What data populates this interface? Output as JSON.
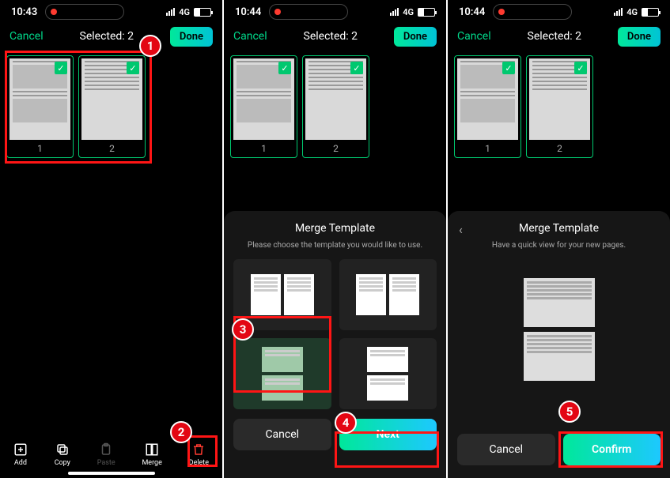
{
  "screens": [
    {
      "status": {
        "time": "10:43",
        "network": "4G"
      },
      "topbar": {
        "cancel": "Cancel",
        "title": "Selected: 2",
        "done": "Done"
      },
      "thumbs": [
        {
          "num": "1"
        },
        {
          "num": "2"
        }
      ],
      "toolbar": {
        "add": "Add",
        "copy": "Copy",
        "paste": "Paste",
        "merge": "Merge",
        "delete": "Delete"
      }
    },
    {
      "status": {
        "time": "10:44",
        "network": "4G"
      },
      "topbar": {
        "cancel": "Cancel",
        "title": "Selected: 2",
        "done": "Done"
      },
      "thumbs": [
        {
          "num": "1"
        },
        {
          "num": "2"
        }
      ],
      "sheet": {
        "title": "Merge Template",
        "subtitle": "Please choose the template you would like to use.",
        "cancel": "Cancel",
        "next": "Next"
      }
    },
    {
      "status": {
        "time": "10:44",
        "network": "4G"
      },
      "topbar": {
        "cancel": "Cancel",
        "title": "Selected: 2",
        "done": "Done"
      },
      "thumbs": [
        {
          "num": "1"
        },
        {
          "num": "2"
        }
      ],
      "sheet": {
        "title": "Merge Template",
        "subtitle": "Have a quick view for your new pages.",
        "cancel": "Cancel",
        "confirm": "Confirm"
      }
    }
  ],
  "annotations": {
    "1": "1",
    "2": "2",
    "3": "3",
    "4": "4",
    "5": "5"
  }
}
